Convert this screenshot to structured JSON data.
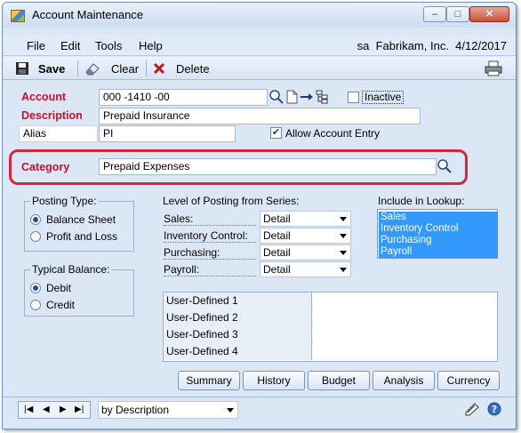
{
  "window": {
    "title": "Account Maintenance",
    "minimize": "–",
    "maximize": "□",
    "close": "✕"
  },
  "menu": {
    "items": [
      "File",
      "Edit",
      "Tools",
      "Help"
    ],
    "user_info": "sa  Fabrikam, Inc.  4/12/2017"
  },
  "toolbar": {
    "save_label": "Save",
    "clear_label": "Clear",
    "delete_label": "Delete"
  },
  "fields": {
    "account_label": "Account",
    "account_value": "000 -1410 -00",
    "inactive_label": "Inactive",
    "inactive_checked": false,
    "description_label": "Description",
    "description_value": "Prepaid Insurance",
    "alias_label": "Alias",
    "alias_value": "PI",
    "allow_entry_label": "Allow Account Entry",
    "allow_entry_checked": true,
    "category_label": "Category",
    "category_value": "Prepaid Expenses"
  },
  "posting_type": {
    "title": "Posting Type:",
    "options": [
      "Balance Sheet",
      "Profit and Loss"
    ],
    "selected": "Balance Sheet"
  },
  "typical_balance": {
    "title": "Typical Balance:",
    "options": [
      "Debit",
      "Credit"
    ],
    "selected": "Debit"
  },
  "level_of_posting": {
    "title": "Level of Posting from Series:",
    "rows": [
      {
        "label": "Sales:",
        "value": "Detail"
      },
      {
        "label": "Inventory Control:",
        "value": "Detail"
      },
      {
        "label": "Purchasing:",
        "value": "Detail"
      },
      {
        "label": "Payroll:",
        "value": "Detail"
      }
    ]
  },
  "include_in_lookup": {
    "title": "Include in Lookup:",
    "items": [
      "Sales",
      "Inventory Control",
      "Purchasing",
      "Payroll"
    ]
  },
  "user_defined": [
    {
      "label": "User-Defined 1",
      "value": ""
    },
    {
      "label": "User-Defined 2",
      "value": ""
    },
    {
      "label": "User-Defined 3",
      "value": ""
    },
    {
      "label": "User-Defined 4",
      "value": ""
    }
  ],
  "buttons": [
    "Summary",
    "History",
    "Budget",
    "Analysis",
    "Currency"
  ],
  "status": {
    "sort_value": "by Description"
  },
  "colors": {
    "accent_red": "#c8102e",
    "highlight_box": "#d2283f",
    "selection_blue": "#3399ff",
    "window_bg": "#dce7f5"
  }
}
